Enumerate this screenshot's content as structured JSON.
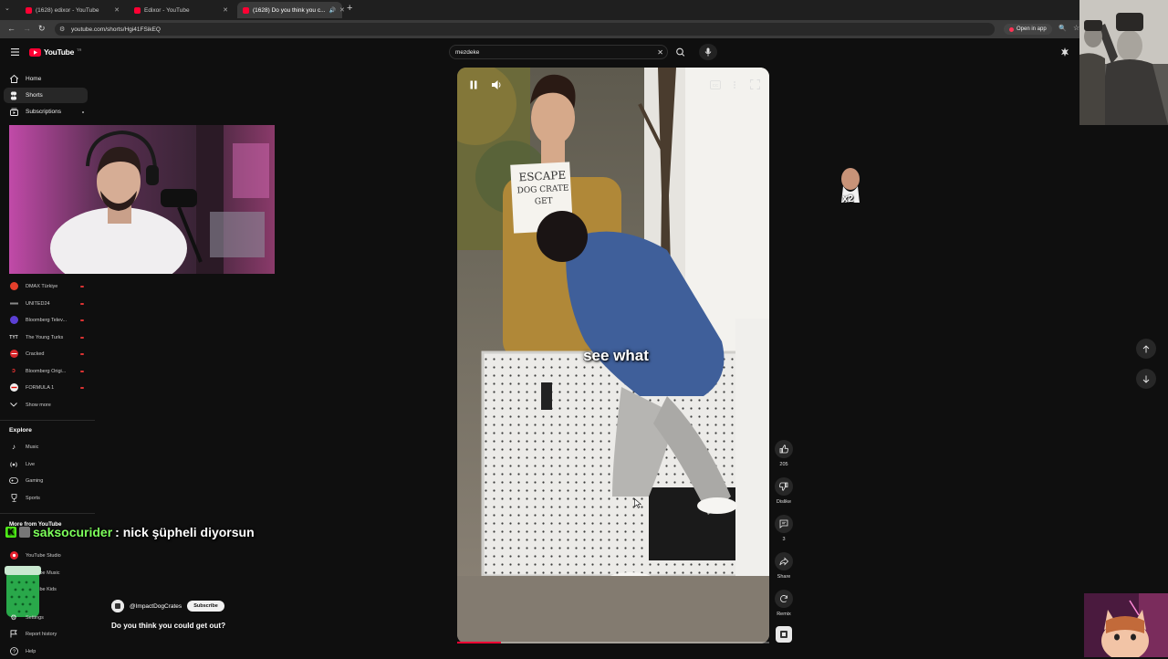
{
  "browser": {
    "tabs": [
      {
        "title": "(1628) edixor - YouTube",
        "active": false
      },
      {
        "title": "Edixor - YouTube",
        "active": false
      },
      {
        "title": "(1628) Do you think you c...",
        "active": true
      }
    ],
    "url": "youtube.com/shorts/Hgi41FSikEQ",
    "open_in_app": "Open in app"
  },
  "youtube": {
    "logo_text": "YouTube",
    "logo_super": "TR",
    "search_value": "mezdeke"
  },
  "sidebar": {
    "main": [
      {
        "label": "Home",
        "icon": "home-icon"
      },
      {
        "label": "Shorts",
        "icon": "shorts-icon"
      },
      {
        "label": "Subscriptions",
        "icon": "subscriptions-icon"
      }
    ],
    "subscriptions": [
      {
        "label": "DMAX Türkiye",
        "color": "#e43f2b"
      },
      {
        "label": "UNITED24",
        "color": "#444444"
      },
      {
        "label": "Bloomberg Telev...",
        "color": "#5b3fd4"
      },
      {
        "label": "The Young Turks",
        "color": "#222222"
      },
      {
        "label": "Cracked",
        "color": "#d7262b"
      },
      {
        "label": "Bloomberg Origi...",
        "color": "#1a1a1a"
      },
      {
        "label": "FORMULA 1",
        "color": "#e10600"
      }
    ],
    "show_more": "Show more",
    "explore_heading": "Explore",
    "explore": [
      {
        "label": "Music",
        "icon": "music-icon"
      },
      {
        "label": "Live",
        "icon": "live-icon"
      },
      {
        "label": "Gaming",
        "icon": "gaming-icon"
      },
      {
        "label": "Sports",
        "icon": "sports-icon"
      }
    ],
    "more_heading": "More from YouTube",
    "more": [
      {
        "label": "YouTube Studio",
        "icon": "studio-icon"
      },
      {
        "label": "YouTube Music",
        "icon": "yt-music-icon"
      },
      {
        "label": "YouTube Kids",
        "icon": "yt-kids-icon"
      }
    ],
    "footer": [
      {
        "label": "Settings",
        "icon": "settings-icon"
      },
      {
        "label": "Report history",
        "icon": "flag-icon"
      },
      {
        "label": "Help",
        "icon": "help-icon"
      }
    ]
  },
  "stream_overlay": {
    "chat_user": "saksocurider",
    "chat_message": ": nick şüpheli diyorsun",
    "reaction_badge": "x2"
  },
  "short": {
    "caption": "see what",
    "sign_line1": "ESCAPE",
    "sign_line2": "DOG CRATE",
    "sign_line3": "GET",
    "progress": 0.14,
    "channel": "@ImpactDogCrates",
    "subscribe_label": "Subscribe",
    "title": "Do you think you could get out?",
    "actions": {
      "like_count": "205",
      "dislike_label": "Dislike",
      "comments_count": "3",
      "share_label": "Share",
      "remix_label": "Remix"
    }
  }
}
